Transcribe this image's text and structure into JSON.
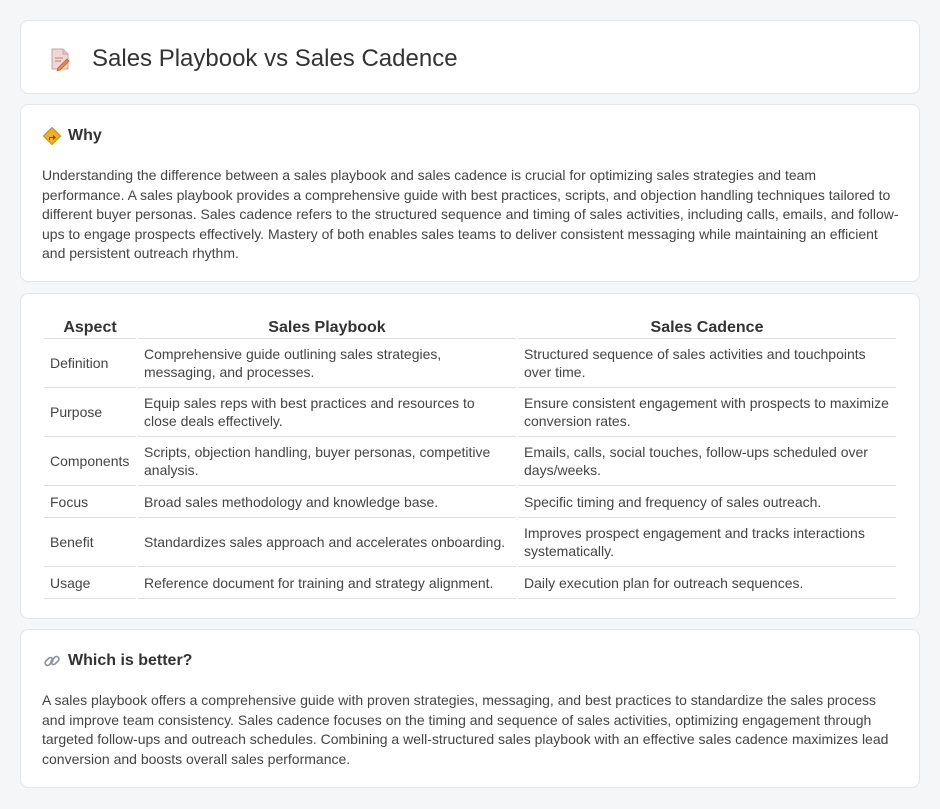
{
  "header": {
    "title": "Sales Playbook vs Sales Cadence",
    "icon": "document-pencil-icon"
  },
  "why": {
    "heading": "Why",
    "icon": "road-sign-icon",
    "text": "Understanding the difference between a sales playbook and sales cadence is crucial for optimizing sales strategies and team performance. A sales playbook provides a comprehensive guide with best practices, scripts, and objection handling techniques tailored to different buyer personas. Sales cadence refers to the structured sequence and timing of sales activities, including calls, emails, and follow-ups to engage prospects effectively. Mastery of both enables sales teams to deliver consistent messaging while maintaining an efficient and persistent outreach rhythm."
  },
  "table": {
    "headers": [
      "Aspect",
      "Sales Playbook",
      "Sales Cadence"
    ],
    "rows": [
      [
        "Definition",
        "Comprehensive guide outlining sales strategies, messaging, and processes.",
        "Structured sequence of sales activities and touchpoints over time."
      ],
      [
        "Purpose",
        "Equip sales reps with best practices and resources to close deals effectively.",
        "Ensure consistent engagement with prospects to maximize conversion rates."
      ],
      [
        "Components",
        "Scripts, objection handling, buyer personas, competitive analysis.",
        "Emails, calls, social touches, follow-ups scheduled over days/weeks."
      ],
      [
        "Focus",
        "Broad sales methodology and knowledge base.",
        "Specific timing and frequency of sales outreach."
      ],
      [
        "Benefit",
        "Standardizes sales approach and accelerates onboarding.",
        "Improves prospect engagement and tracks interactions systematically."
      ],
      [
        "Usage",
        "Reference document for training and strategy alignment.",
        "Daily execution plan for outreach sequences."
      ]
    ]
  },
  "better": {
    "heading": "Which is better?",
    "icon": "link-icon",
    "text": "A sales playbook offers a comprehensive guide with proven strategies, messaging, and best practices to standardize the sales process and improve team consistency. Sales cadence focuses on the timing and sequence of sales activities, optimizing engagement through targeted follow-ups and outreach schedules. Combining a well-structured sales playbook with an effective sales cadence maximizes lead conversion and boosts overall sales performance."
  }
}
